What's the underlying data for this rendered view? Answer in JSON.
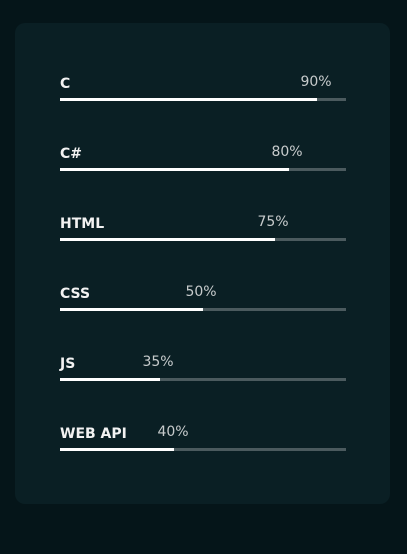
{
  "skills": [
    {
      "name": "C",
      "percent_label": "90%",
      "level": 0.9
    },
    {
      "name": "C#",
      "percent_label": "80%",
      "level": 0.8
    },
    {
      "name": "HTML",
      "percent_label": "75%",
      "level": 0.75
    },
    {
      "name": "CSS",
      "percent_label": "50%",
      "level": 0.5
    },
    {
      "name": "JS",
      "percent_label": "35%",
      "level": 0.35
    },
    {
      "name": "WEB API",
      "percent_label": "40%",
      "level": 0.4
    }
  ],
  "colors": {
    "background": "#051519",
    "card": "#0a1f24",
    "track": "#4b5a5e",
    "fill": "#ffffff"
  }
}
